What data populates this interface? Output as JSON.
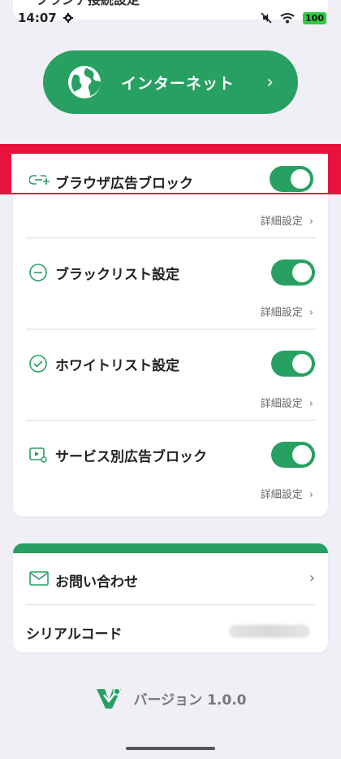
{
  "status_bar": {
    "time": "14:07",
    "battery": "100"
  },
  "top_card": {
    "title_partial": "ブランチ接続設定"
  },
  "internet_button": {
    "label": "インターネット"
  },
  "settings": {
    "rows": [
      {
        "title": "ブラウザ広告ブロック",
        "detail": "詳細設定",
        "enabled": true
      },
      {
        "title": "ブラックリスト設定",
        "detail": "詳細設定",
        "enabled": true
      },
      {
        "title": "ホワイトリスト設定",
        "detail": "詳細設定",
        "enabled": true
      },
      {
        "title": "サービス別広告ブロック",
        "detail": "詳細設定",
        "enabled": true
      }
    ]
  },
  "contact": {
    "inquiry_label": "お問い合わせ",
    "serial_label": "シリアルコード"
  },
  "version": {
    "text": "バージョン 1.0.0"
  },
  "colors": {
    "accent": "#27a062",
    "highlight": "#e8123f",
    "background": "#f0eff5"
  }
}
